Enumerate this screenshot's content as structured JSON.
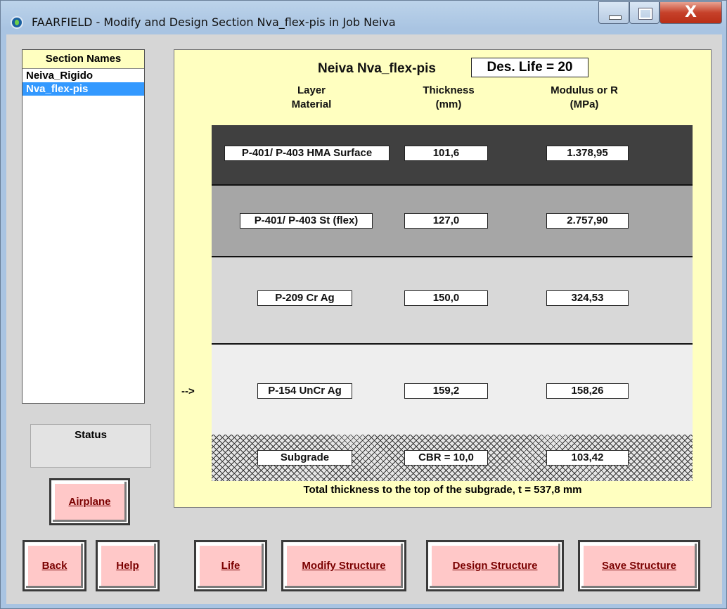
{
  "window": {
    "title": "FAARFIELD - Modify and Design Section Nva_flex-pis in Job Neiva",
    "close_glyph": "X"
  },
  "sidebar": {
    "header": "Section Names",
    "items": [
      "Neiva_Rigido",
      "Nva_flex-pis"
    ],
    "selected_index": 1,
    "status_label": "Status"
  },
  "main": {
    "job_section": "Neiva  Nva_flex-pis",
    "des_life": "Des. Life = 20",
    "col_layer": [
      "Layer",
      "Material"
    ],
    "col_thickness": [
      "Thickness",
      "(mm)"
    ],
    "col_modulus": [
      "Modulus or R",
      "(MPa)"
    ],
    "arrow": "-->",
    "layers": [
      {
        "material": "P-401/ P-403 HMA Surface",
        "thickness": "101,6",
        "modulus": "1.378,95",
        "color": "#404040"
      },
      {
        "material": "P-401/ P-403 St (flex)",
        "thickness": "127,0",
        "modulus": "2.757,90",
        "color": "#a6a6a6"
      },
      {
        "material": "P-209 Cr Ag",
        "thickness": "150,0",
        "modulus": "324,53",
        "color": "#d8d8d8"
      },
      {
        "material": "P-154 UnCr Ag",
        "thickness": "159,2",
        "modulus": "158,26",
        "color": "#eeeeee"
      }
    ],
    "subgrade": {
      "material": "Subgrade",
      "thickness": "CBR = 10,0",
      "modulus": "103,42"
    },
    "total": "Total thickness to the top of the subgrade, t = 537,8 mm"
  },
  "buttons": {
    "airplane": "Airplane",
    "back": "Back",
    "help": "Help",
    "life": "Life",
    "modify": "Modify Structure",
    "design": "Design Structure",
    "save": "Save Structure"
  },
  "colors": {
    "panel_bg": "#ffffc0",
    "button_bg": "#ffc8c8",
    "button_text": "#7a0000",
    "selection": "#3399ff"
  }
}
